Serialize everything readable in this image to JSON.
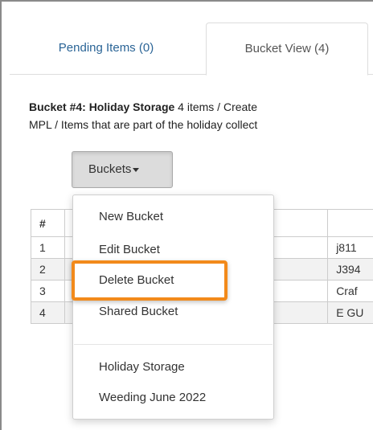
{
  "tabs": [
    {
      "label": "Pending Items (0)",
      "active": false
    },
    {
      "label": "Bucket View (4)",
      "active": true
    }
  ],
  "bucket": {
    "title_bold": "Bucket #4: Holiday Storage",
    "title_rest": " 4 items / Create",
    "line2": "MPL / Items that are part of the holiday collect"
  },
  "buckets_button": {
    "label": "Buckets"
  },
  "table": {
    "header": [
      "#",
      "",
      ""
    ],
    "rows": [
      {
        "num": "1",
        "right": "j811"
      },
      {
        "num": "2",
        "right": "J394"
      },
      {
        "num": "3",
        "right": "Craf"
      },
      {
        "num": "4",
        "right": "E GU"
      }
    ]
  },
  "dropdown": {
    "actions": [
      "New Bucket",
      "Edit Bucket",
      "Delete Bucket",
      "Shared Bucket"
    ],
    "buckets": [
      "Holiday Storage",
      "Weeding June 2022"
    ]
  },
  "colors": {
    "highlight": "#f28a1b",
    "link": "#2a6496"
  }
}
